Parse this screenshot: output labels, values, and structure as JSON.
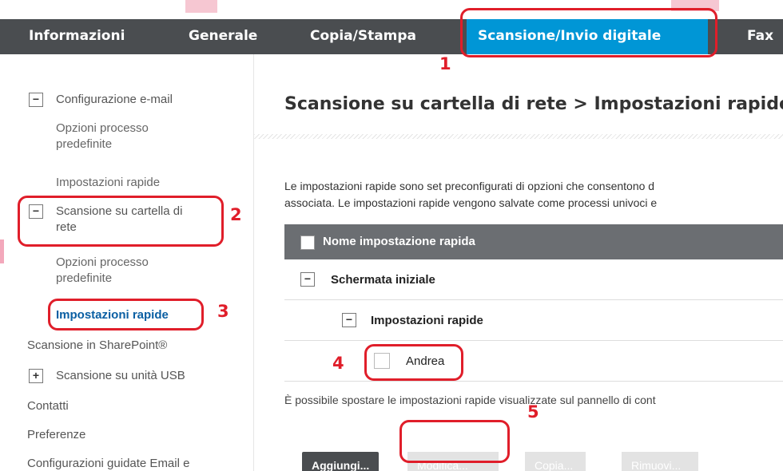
{
  "nav": {
    "tabs": [
      {
        "label": "Informazioni"
      },
      {
        "label": "Generale"
      },
      {
        "label": "Copia/Stampa"
      },
      {
        "label": "Scansione/Invio digitale",
        "active": true
      },
      {
        "label": "Fax"
      }
    ]
  },
  "sidebar": {
    "items": [
      {
        "label": "Configurazione e-mail",
        "toggle": "−"
      },
      {
        "label": "Opzioni processo",
        "label2": "predefinite"
      },
      {
        "label": "Impostazioni rapide"
      },
      {
        "label": "Scansione su cartella di",
        "label2": "rete",
        "toggle": "−"
      },
      {
        "label": "Opzioni processo",
        "label2": "predefinite"
      },
      {
        "label": "Impostazioni rapide",
        "active": true
      },
      {
        "label": "Scansione in SharePoint®"
      },
      {
        "label": "Scansione su unità USB",
        "toggle": "+"
      },
      {
        "label": "Contatti"
      },
      {
        "label": "Preferenze"
      },
      {
        "label": "Configurazioni guidate Email e"
      }
    ]
  },
  "main": {
    "title": "Scansione su cartella di rete > Impostazioni rapide",
    "description_line1": "Le impostazioni rapide sono set preconfigurati di opzioni che consentono d",
    "description_line2": "associata. Le impostazioni rapide vengono salvate come processi univoci e",
    "table": {
      "header": "Nome impostazione rapida",
      "group": "Schermata iniziale",
      "group_toggle": "−",
      "subgroup": "Impostazioni rapide",
      "subgroup_toggle": "−",
      "item": "Andrea"
    },
    "note": "È possibile spostare le impostazioni rapide visualizzate sul pannello di cont",
    "buttons": {
      "add": "Aggiungi...",
      "edit": "Modifica...",
      "copy": "Copia...",
      "remove": "Rimuovi..."
    }
  },
  "annotations": [
    "1",
    "2",
    "3",
    "4",
    "5"
  ],
  "colors": {
    "nav_bg": "#4a4d50",
    "active_tab": "#0096d6",
    "annotation": "#e01e2a",
    "active_link": "#0a5fa3"
  }
}
